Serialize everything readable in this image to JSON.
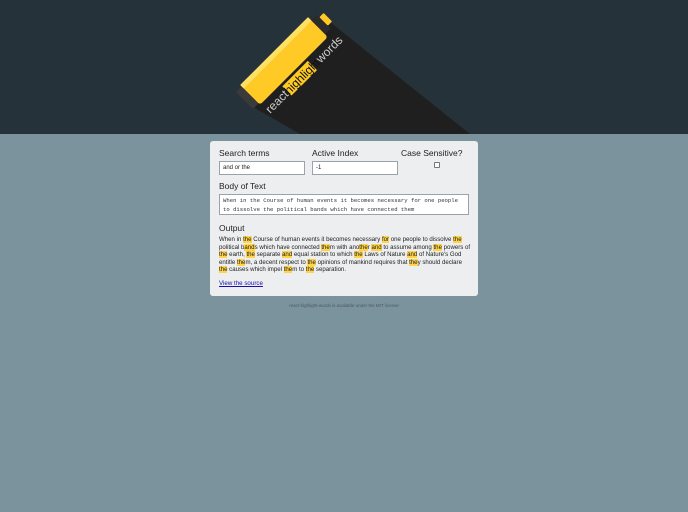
{
  "header": {
    "logo_text_left": "react",
    "logo_text_highlight": "highlight",
    "logo_text_right": "words"
  },
  "form": {
    "search_terms_label": "Search terms",
    "search_terms_value": "and or the",
    "active_index_label": "Active Index",
    "active_index_value": "-1",
    "case_sensitive_label": "Case Sensitive?",
    "case_sensitive_checked": false,
    "body_label": "Body of Text",
    "body_value": "When in the Course of human events it becomes necessary for one people to dissolve the political bands which have connected them",
    "output_label": "Output",
    "output_segments": [
      {
        "text": "When in ",
        "hl": false
      },
      {
        "text": "the",
        "hl": true
      },
      {
        "text": " Course of human events it becomes necessary ",
        "hl": false
      },
      {
        "text": "for",
        "hl": true
      },
      {
        "text": " one people to dissolve ",
        "hl": false
      },
      {
        "text": "the",
        "hl": true
      },
      {
        "text": " political b",
        "hl": false
      },
      {
        "text": "and",
        "hl": true
      },
      {
        "text": "s which have connected ",
        "hl": false
      },
      {
        "text": "the",
        "hl": true
      },
      {
        "text": "m with ano",
        "hl": false
      },
      {
        "text": "the",
        "hl": true
      },
      {
        "text": "r ",
        "hl": false
      },
      {
        "text": "and",
        "hl": true
      },
      {
        "text": " to assume among ",
        "hl": false
      },
      {
        "text": "the",
        "hl": true
      },
      {
        "text": " powers of ",
        "hl": false
      },
      {
        "text": "the",
        "hl": true
      },
      {
        "text": " earth, ",
        "hl": false
      },
      {
        "text": "the",
        "hl": true
      },
      {
        "text": " separate ",
        "hl": false
      },
      {
        "text": "and",
        "hl": true
      },
      {
        "text": " equal station to which ",
        "hl": false
      },
      {
        "text": "the",
        "hl": true
      },
      {
        "text": " Laws of Nature ",
        "hl": false
      },
      {
        "text": "and",
        "hl": true
      },
      {
        "text": " of Nature's God entitle ",
        "hl": false
      },
      {
        "text": "the",
        "hl": true
      },
      {
        "text": "m, a decent respect to ",
        "hl": false
      },
      {
        "text": "the",
        "hl": true
      },
      {
        "text": " opinions of mankind requires that ",
        "hl": false
      },
      {
        "text": "the",
        "hl": true
      },
      {
        "text": "y should declare ",
        "hl": false
      },
      {
        "text": "the",
        "hl": true
      },
      {
        "text": " causes which impel ",
        "hl": false
      },
      {
        "text": "the",
        "hl": true
      },
      {
        "text": "m to ",
        "hl": false
      },
      {
        "text": "the",
        "hl": true
      },
      {
        "text": " separation.",
        "hl": false
      }
    ],
    "source_link": "View the source"
  },
  "footer": {
    "text": "react-highlight-words is available under the MIT license"
  },
  "colors": {
    "header_bg": "#26323a",
    "page_bg": "#7b939d",
    "highlight": "#ffd34a",
    "card_bg": "#eceeef"
  }
}
